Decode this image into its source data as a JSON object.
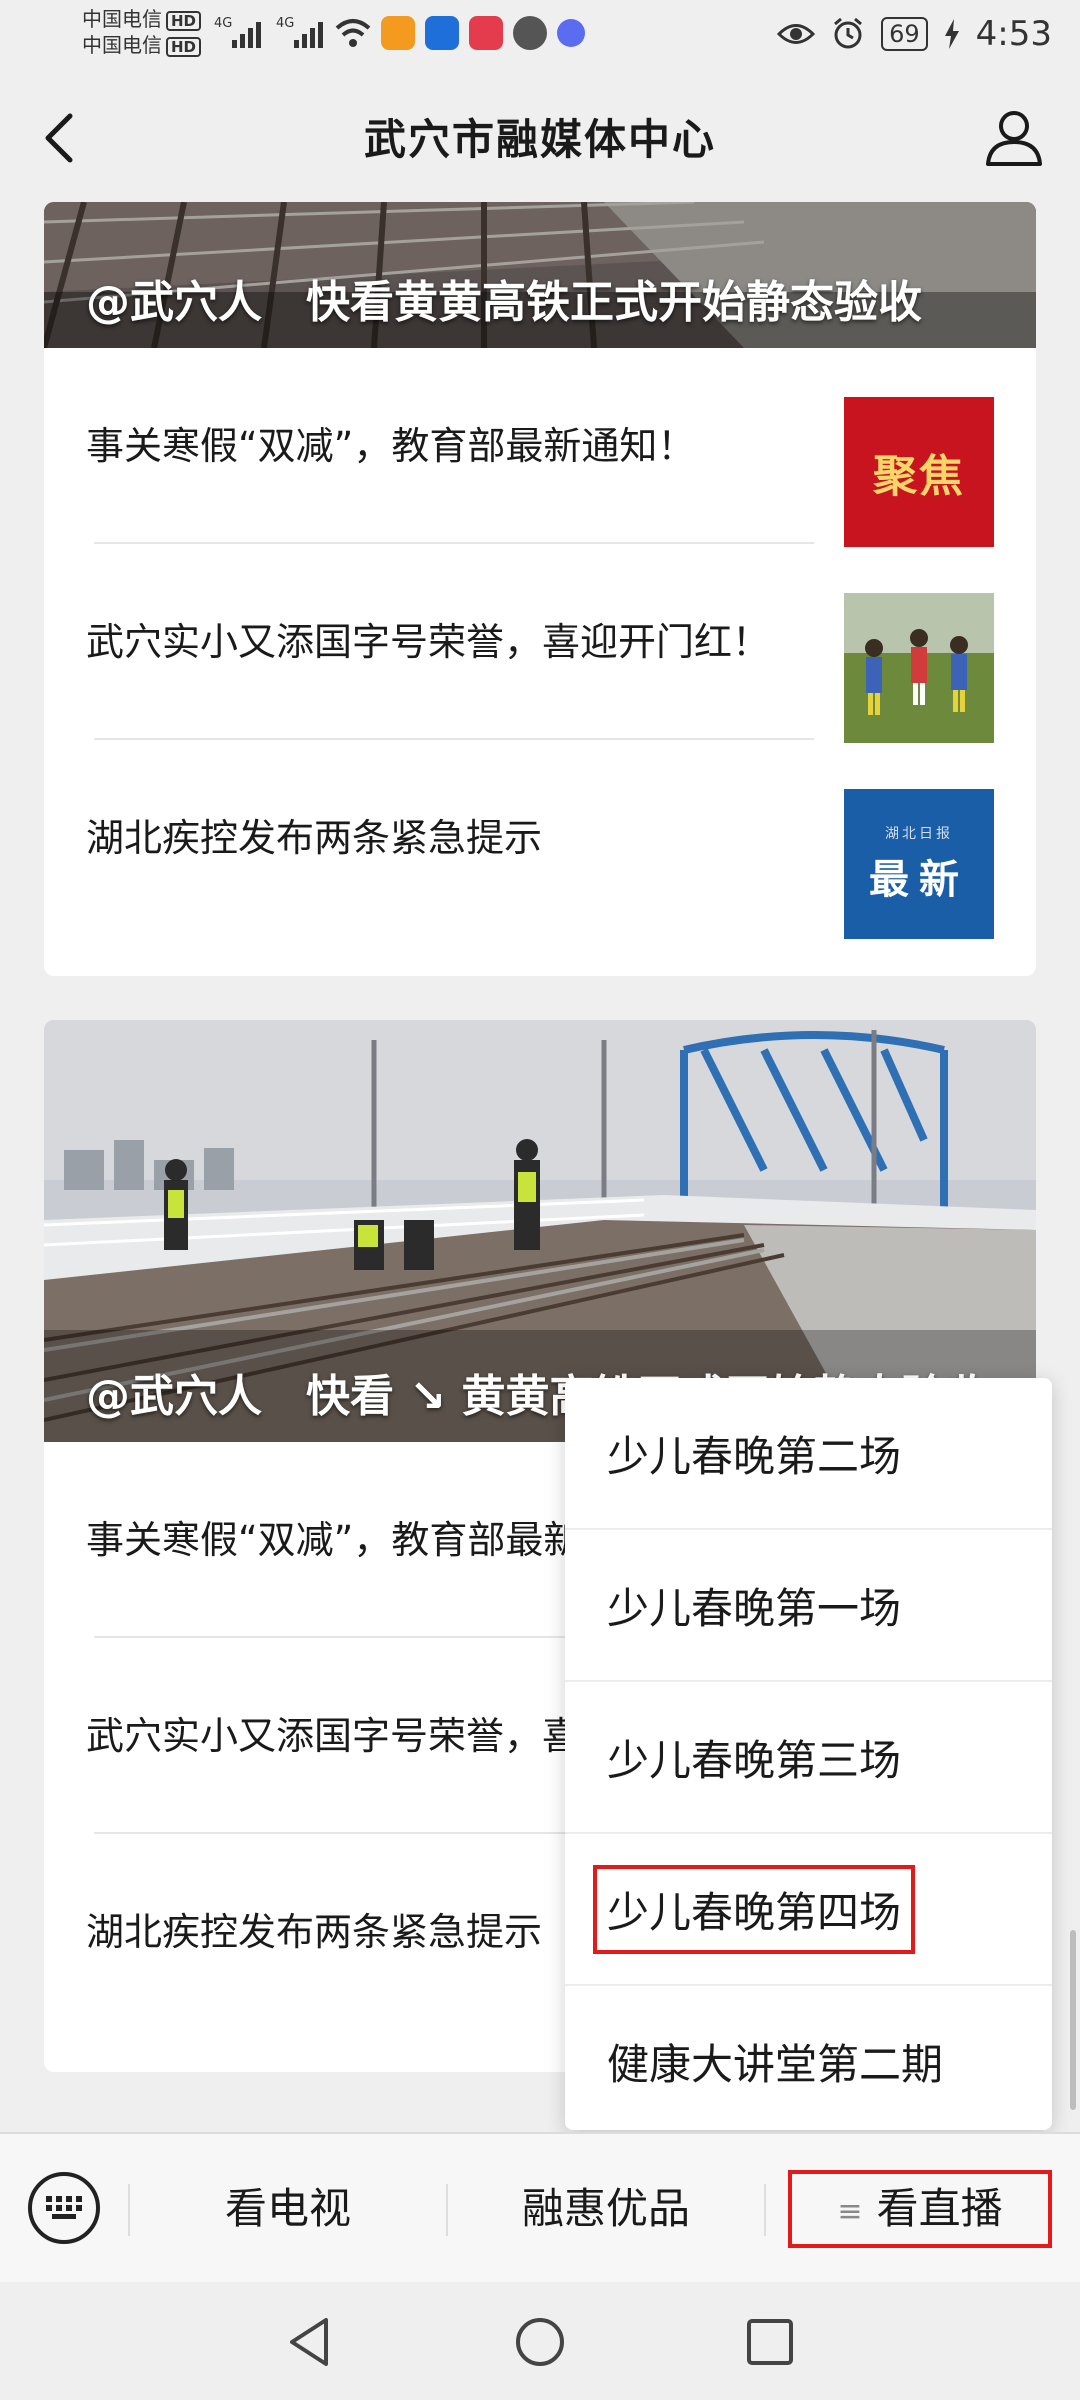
{
  "status_bar": {
    "carrier_1": "中国电信",
    "carrier_2": "中国电信",
    "hd_badge": "HD",
    "network": "4G",
    "battery": "69",
    "time": "4:53"
  },
  "header": {
    "title": "武穴市融媒体中心"
  },
  "cards": [
    {
      "hero_caption": "@武穴人　快看黄黄高铁正式开始静态验收",
      "items": [
        {
          "title": "事关寒假“双减”，教育部最新通知！",
          "thumb_text": "聚焦"
        },
        {
          "title": "武穴实小又添国字号荣誉，喜迎开门红！"
        },
        {
          "title": "湖北疾控发布两条紧急提示",
          "thumb_small": "湖北日报",
          "thumb_text": "最新"
        }
      ]
    },
    {
      "hero_caption": "@武穴人　快看 ↘ 黄黄高铁正式开始静态验收",
      "items": [
        {
          "title": "事关寒假“双减”，教育部最新通知！"
        },
        {
          "title": "武穴实小又添国字号荣誉，喜迎开门红！"
        },
        {
          "title": "湖北疾控发布两条紧急提示"
        }
      ]
    }
  ],
  "popup_menu": {
    "items": [
      "少儿春晚第二场",
      "少儿春晚第一场",
      "少儿春晚第三场",
      "少儿春晚第四场",
      "健康大讲堂第二期"
    ],
    "highlighted_index": 3
  },
  "bottom_nav": {
    "tabs": [
      "看电视",
      "融惠优品",
      "看直播"
    ]
  },
  "colors": {
    "highlight": "#e21a1a",
    "background": "#efefef"
  }
}
